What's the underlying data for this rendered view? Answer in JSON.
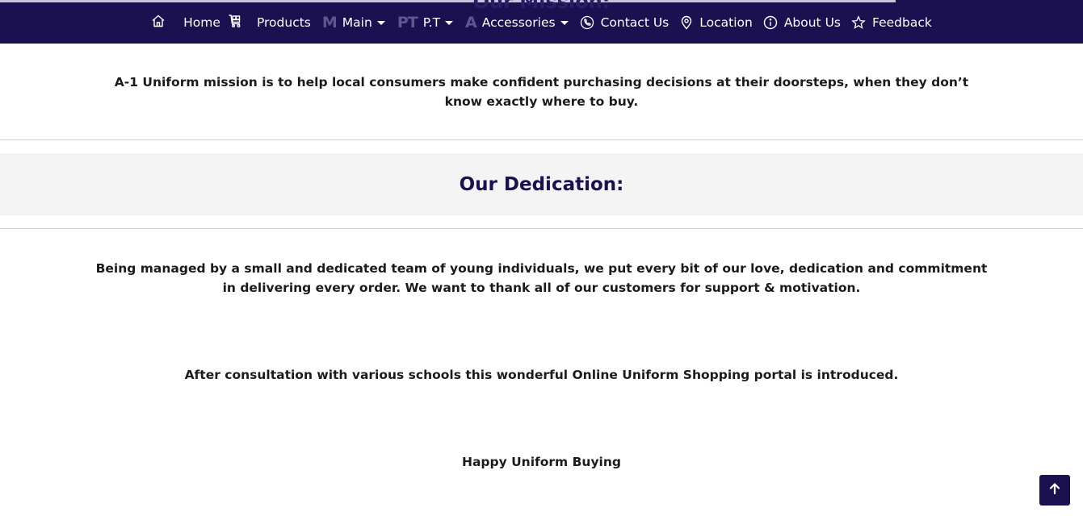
{
  "nav": {
    "ghost_title": "Our Mission:",
    "items": [
      {
        "label": "Home",
        "icon": "home-icon"
      },
      {
        "label": "Products",
        "icon": "cart-icon"
      },
      {
        "label": "Main",
        "icon_letters": "M",
        "dropdown": true
      },
      {
        "label": "P.T",
        "icon_letters": "PT",
        "dropdown": true
      },
      {
        "label": "Accessories",
        "icon_letters": "A",
        "dropdown": true
      },
      {
        "label": "Contact Us",
        "icon": "phone-icon"
      },
      {
        "label": "Location",
        "icon": "location-pin-icon"
      },
      {
        "label": "About Us",
        "icon": "info-icon"
      },
      {
        "label": "Feedback",
        "icon": "star-icon"
      }
    ]
  },
  "mission": {
    "text": "A-1 Uniform mission is to help local consumers make confident purchasing decisions at their doorsteps, when they don’t know exactly where to buy."
  },
  "dedication": {
    "title": "Our Dedication:",
    "paragraphs": [
      "Being managed by a small and dedicated team of young individuals, we put every bit of our love, dedication and commitment in delivering every order. We want to thank all of our customers for support & motivation.",
      "After consultation with various schools this wonderful Online Uniform Shopping portal is introduced.",
      "Happy Uniform Buying"
    ]
  },
  "back_to_top": {
    "icon": "arrow-up-icon"
  },
  "colors": {
    "navbar": "#1c1150",
    "heading": "#1c1150",
    "band": "#f4f4f4"
  }
}
